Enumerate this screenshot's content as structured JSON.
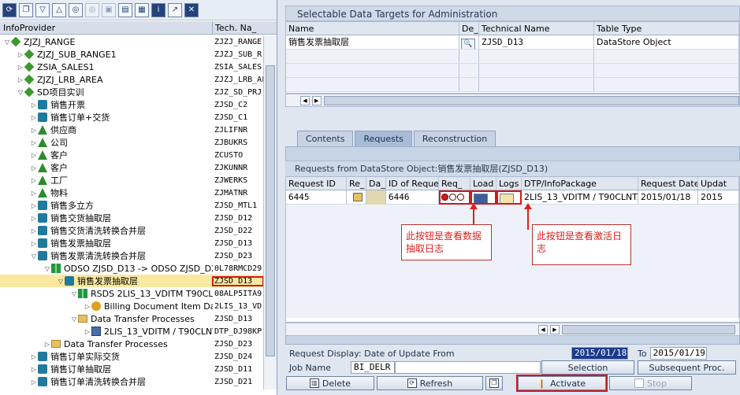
{
  "left": {
    "toolbar_icons": [
      "refresh-icon",
      "copy-icon",
      "filter-icon",
      "collapse-icon",
      "binoculars-icon",
      "disabled-icon",
      "disabled-icon",
      "execute-icon",
      "display-icon",
      "info-icon",
      "pin-icon",
      "close-icon"
    ],
    "header": {
      "col1": "InfoProvider",
      "col2": "Tech. Na_"
    },
    "tree": [
      {
        "indent": 0,
        "arrow": "▽",
        "icon": "diamond",
        "name": "ZJZJ_RANGE",
        "tech": "ZJZJ_RANGE"
      },
      {
        "indent": 1,
        "arrow": "▷",
        "icon": "diamond",
        "name": "ZJZJ_SUB_RANGE1",
        "tech": "ZJZJ_SUB_R"
      },
      {
        "indent": 1,
        "arrow": "▷",
        "icon": "diamond",
        "name": "ZSIA_SALES1",
        "tech": "ZSIA_SALES"
      },
      {
        "indent": 1,
        "arrow": "▷",
        "icon": "diamond",
        "name": "ZJZJ_LRB_AREA",
        "tech": "ZJZJ_LRB_AF"
      },
      {
        "indent": 1,
        "arrow": "▽",
        "icon": "diamond",
        "name": "SD项目实训",
        "tech": "ZJZ_SD_PRJ"
      },
      {
        "indent": 2,
        "arrow": "▷",
        "icon": "cube",
        "name": "销售开票",
        "tech": "ZJSD_C2"
      },
      {
        "indent": 2,
        "arrow": "▷",
        "icon": "cube",
        "name": "销售订单+交货",
        "tech": "ZJSD_C1"
      },
      {
        "indent": 2,
        "arrow": "▷",
        "icon": "tri",
        "name": "供应商",
        "tech": "ZJLIFNR"
      },
      {
        "indent": 2,
        "arrow": "▷",
        "icon": "tri",
        "name": "公司",
        "tech": "ZJBUKRS"
      },
      {
        "indent": 2,
        "arrow": "▷",
        "icon": "tri",
        "name": "客户",
        "tech": "ZCUSTO"
      },
      {
        "indent": 2,
        "arrow": "▷",
        "icon": "tri",
        "name": "客户",
        "tech": "ZJKUNNR"
      },
      {
        "indent": 2,
        "arrow": "▷",
        "icon": "tri",
        "name": "工厂",
        "tech": "ZJWERKS"
      },
      {
        "indent": 2,
        "arrow": "▷",
        "icon": "tri",
        "name": "物料",
        "tech": "ZJMATNR"
      },
      {
        "indent": 2,
        "arrow": "▷",
        "icon": "cube",
        "name": "销售多立方",
        "tech": "ZJSD_MTL1"
      },
      {
        "indent": 2,
        "arrow": "▷",
        "icon": "cube",
        "name": "销售交货抽取层",
        "tech": "ZJSD_D12"
      },
      {
        "indent": 2,
        "arrow": "▷",
        "icon": "cube",
        "name": "销售交货清洗转换合并层",
        "tech": "ZJSD_D22"
      },
      {
        "indent": 2,
        "arrow": "▷",
        "icon": "cube",
        "name": "销售发票抽取层",
        "tech": "ZJSD_D13"
      },
      {
        "indent": 2,
        "arrow": "▽",
        "icon": "cube",
        "name": "销售发票清洗转换合并层",
        "tech": "ZJSD_D23"
      },
      {
        "indent": 3,
        "arrow": "▽",
        "icon": "bow",
        "name": "ODSO ZJSD_D13 -> ODSO ZJSD_D23",
        "tech": "0L78RMCD29"
      },
      {
        "indent": 4,
        "arrow": "▽",
        "icon": "cube",
        "name": "销售发票抽取层",
        "tech": "ZJSD_D13",
        "selected": true,
        "boxed": true
      },
      {
        "indent": 5,
        "arrow": "▽",
        "icon": "bow",
        "name": "RSDS 2LIS_13_VDITM T90CLNT090",
        "tech": "08ALP5ITA9"
      },
      {
        "indent": 6,
        "arrow": "▷",
        "icon": "gear",
        "name": "Billing Document Item Data",
        "tech": "2LIS_13_VD"
      },
      {
        "indent": 5,
        "arrow": "▽",
        "icon": "folder",
        "name": "Data Transfer Processes",
        "tech": "ZJSD_D13"
      },
      {
        "indent": 6,
        "arrow": "▷",
        "icon": "dtp",
        "name": "2LIS_13_VDITM / T90CLNT090",
        "tech": "DTP_DJ98KP"
      },
      {
        "indent": 3,
        "arrow": "▷",
        "icon": "folder",
        "name": "Data Transfer Processes",
        "tech": "ZJSD_D23"
      },
      {
        "indent": 2,
        "arrow": "▷",
        "icon": "cube",
        "name": "销售订单实际交货",
        "tech": "ZJSD_D24"
      },
      {
        "indent": 2,
        "arrow": "▷",
        "icon": "cube",
        "name": "销售订单抽取层",
        "tech": "ZJSD_D11"
      },
      {
        "indent": 2,
        "arrow": "▷",
        "icon": "cube",
        "name": "销售订单清洗转换合并层",
        "tech": "ZJSD_D21"
      }
    ]
  },
  "targets": {
    "title": "Selectable Data Targets for Administration",
    "headers": [
      "Name",
      "De_",
      "Technical Name",
      "Table Type"
    ],
    "row": {
      "name": "销售发票抽取层",
      "tech": "ZJSD_D13",
      "type": "DataStore Object"
    }
  },
  "tabs": [
    "Contents",
    "Requests",
    "Reconstruction"
  ],
  "requests": {
    "title": "Requests from DataStore Object:销售发票抽取层(ZJSD_D13)",
    "headers": [
      "Request ID",
      "Re_",
      "Da_",
      "ID of Reques_",
      "Req_",
      "Load",
      "Logs",
      "DTP/InfoPackage",
      "Request Date",
      "Updat"
    ],
    "row": {
      "id": "6445",
      "req_id": "6446",
      "dtp": "2LIS_13_VDITM / T90CLNT...",
      "date": "2015/01/18",
      "upd": "2015"
    }
  },
  "annotations": {
    "load_note": "此按钮是查看数据抽取日志",
    "logs_note": "此按钮是查看激活日志"
  },
  "bottom": {
    "display_label": "Request Display: Date of Update From",
    "date_from": "2015/01/18",
    "to_label": "To",
    "date_to": "2015/01/19",
    "job_label": "Job Name",
    "job_value": "BI_DELR",
    "selection": "Selection",
    "subsequent": "Subsequent Proc.",
    "delete": "Delete",
    "refresh": "Refresh",
    "activate": "Activate",
    "stop": "Stop"
  },
  "colors": {
    "accent_red": "#d2181e",
    "highlight": "#1d3a8a",
    "selection": "#f9e8a0"
  }
}
